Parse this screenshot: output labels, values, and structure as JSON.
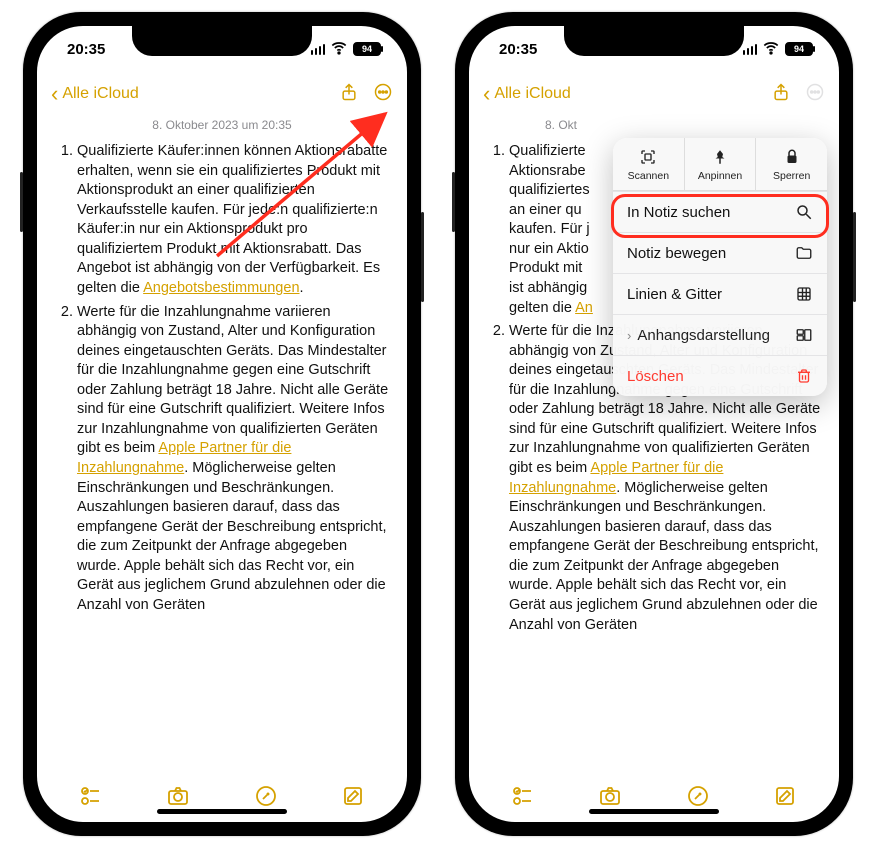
{
  "status": {
    "time": "20:35",
    "battery": "94"
  },
  "nav": {
    "back": "Alle iCloud"
  },
  "note": {
    "timestamp": "8. Oktober 2023 um 20:35",
    "item1_a": "Qualifizierte Käufer:innen können Aktionsrabatte erhalten, wenn sie ein qualifiziertes Produkt mit Aktionsprodukt an einer qualifizierten Verkaufsstelle kaufen. Für jede:n qualifizierte:n Käufer:in nur ein Aktionsprodukt pro qualifiziertem Produkt mit Aktionsrabatt. Das Angebot ist abhängig von der Verfügbarkeit. Es gelten die ",
    "item1_link": "Angebotsbestimmungen",
    "item1_b": ".",
    "item2_a": "Werte für die Inzahlungnahme variieren abhängig von Zustand, Alter und Konfiguration deines eingetauschten Geräts. Das Mindestalter für die Inzahlungnahme gegen eine Gutschrift oder Zahlung beträgt 18 Jahre. Nicht alle Geräte sind für eine Gutschrift qualifiziert. Weitere Infos zur Inzahlungnahme von qualifizierten Geräten gibt es beim ",
    "item2_link": "Apple Partner für die Inzahlungnahme",
    "item2_b": ". Möglicherweise gelten Einschränkungen und Beschränkungen. Auszahlungen basieren darauf, dass das empfangene Gerät der Beschreibung entspricht, die zum Zeitpunkt der Anfrage abgegeben wurde. Apple behält sich das Recht vor, ein Gerät aus jeglichem Grund abzulehnen oder die Anzahl von Geräten"
  },
  "note2": {
    "timestamp_vis": "8. Okt",
    "item1_a": "Qualifizierte ",
    "item1_b": "Aktionsrabe ",
    "item1_c": "qualifiziertes ",
    "item1_d": "an einer qu ",
    "item1_e": "kaufen. Für j ",
    "item1_f": "nur ein Aktio ",
    "item1_g": "Produkt mit ",
    "item1_h": "ist abhängig ",
    "item1_i": "gelten die ",
    "item1_link_partial": "An"
  },
  "menu": {
    "scan": "Scannen",
    "pin": "Anpinnen",
    "lock": "Sperren",
    "search": "In Notiz suchen",
    "move": "Notiz bewegen",
    "lines": "Linien & Gitter",
    "attach": "Anhangsdarstellung",
    "delete": "Löschen"
  }
}
